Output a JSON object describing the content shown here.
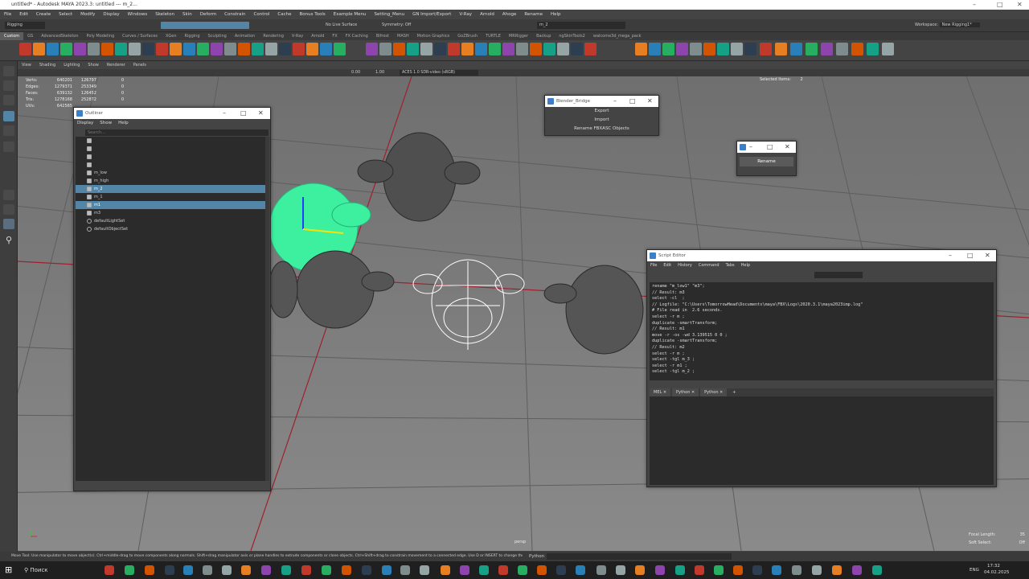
{
  "app": {
    "title": "untitled* - Autodesk MAYA 2023.3: untitled  ---  m_2...",
    "workspace_label": "Workspace:",
    "workspace_value": "New Rigging1*"
  },
  "menubar": [
    "File",
    "Edit",
    "Create",
    "Select",
    "Modify",
    "Display",
    "Windows",
    "Skeleton",
    "Skin",
    "Deform",
    "Constrain",
    "Control",
    "Cache",
    "Bonus Tools",
    "Example Menu",
    "Setting_Menu",
    "GN Import/Export",
    "V-Ray",
    "Arnold",
    "Ahoge",
    "Rename",
    "Help"
  ],
  "statusline": {
    "menuset": "Rigging",
    "live": "No Live Surface",
    "symmetry": "Symmetry: Off",
    "search": "m_2"
  },
  "shelf_tabs": [
    "Custom",
    "GS",
    "AdvancedSkeleton",
    "Poly Modeling",
    "Curves / Surfaces",
    "XGen",
    "Rigging",
    "Sculpting",
    "Animation",
    "Rendering",
    "V-Ray",
    "Arnold",
    "FX",
    "FX Caching",
    "Bifrost",
    "MASH",
    "Motion Graphics",
    "GoZBrush",
    "TURTLE",
    "MRRigger",
    "Backup",
    "ngSkinTools2",
    "walcome3d_mega_pack"
  ],
  "panel_menu": [
    "View",
    "Shading",
    "Lighting",
    "Show",
    "Renderer",
    "Panels"
  ],
  "panel_toolbar": {
    "value1": "0.00",
    "value2": "1.00",
    "colorspace": "ACES 1.0 SDR-video (sRGB)"
  },
  "hud": {
    "rows": [
      {
        "label": "Verts:",
        "a": "640201",
        "b": "126797",
        "c": "0"
      },
      {
        "label": "Edges:",
        "a": "1279371",
        "b": "253349",
        "c": "0"
      },
      {
        "label": "Faces:",
        "a": "639132",
        "b": "126452",
        "c": "0"
      },
      {
        "label": "Tris:",
        "a": "1278168",
        "b": "252872",
        "c": "0"
      },
      {
        "label": "UVs:",
        "a": "642565",
        "b": "",
        "c": ""
      }
    ],
    "selected_label": "Selected Items:",
    "selected_value": "2",
    "camera": "persp",
    "focal_label": "Focal Length:",
    "focal_value": "35",
    "softsel_label": "Soft Select:",
    "softsel_value": "Off"
  },
  "outliner": {
    "title": "Outliner",
    "menu": [
      "Display",
      "Show",
      "Help"
    ],
    "search_placeholder": "Search...",
    "items": [
      {
        "name": "",
        "selected": false,
        "dim": true,
        "type": "mesh"
      },
      {
        "name": "",
        "selected": false,
        "dim": true,
        "type": "mesh"
      },
      {
        "name": "",
        "selected": false,
        "dim": true,
        "type": "mesh"
      },
      {
        "name": "",
        "selected": false,
        "dim": true,
        "type": "mesh"
      },
      {
        "name": "m_low",
        "selected": false,
        "dim": false,
        "type": "mesh"
      },
      {
        "name": "m_high",
        "selected": false,
        "dim": false,
        "type": "mesh"
      },
      {
        "name": "m_2",
        "selected": true,
        "dim": false,
        "type": "mesh"
      },
      {
        "name": "m_1",
        "selected": false,
        "dim": false,
        "type": "mesh"
      },
      {
        "name": "m1",
        "selected": true,
        "dim": false,
        "type": "mesh"
      },
      {
        "name": "m3",
        "selected": false,
        "dim": false,
        "type": "mesh"
      },
      {
        "name": "defaultLightSet",
        "selected": false,
        "dim": false,
        "type": "set"
      },
      {
        "name": "defaultObjectSet",
        "selected": false,
        "dim": false,
        "type": "set"
      }
    ]
  },
  "blender_bridge": {
    "title": "Blender_Bridge",
    "buttons": [
      "Export",
      "Import",
      "Rename FBXASC Objects"
    ]
  },
  "rename_window": {
    "button": "Rename"
  },
  "script_editor": {
    "title": "Script Editor",
    "menu": [
      "File",
      "Edit",
      "History",
      "Command",
      "Tabs",
      "Help"
    ],
    "history": [
      "rename \"m_low1\" \"m3\";",
      "// Result: m3",
      "select -cl  ;",
      "// Logfile: \"C:\\Users\\TomorrowHead\\Documents\\maya\\FBX\\Logs\\2020.3.1\\maya2023imp.log\"",
      "# File read in  2.6 seconds.",
      "select -r m ;",
      "duplicate -smartTransform;",
      "// Result: m1",
      "move -r -os -wd 3.139515 0 0 ;",
      "duplicate -smartTransform;",
      "// Result: m2",
      "select -r m ;",
      "select -tgl m_3 ;",
      "select -r m1 ;",
      "select -tgl m_2 ;"
    ],
    "tabs": [
      "MEL",
      "Python",
      "Python"
    ]
  },
  "helpline": {
    "text": "Move Tool: Use manipulator to move object(s). Ctrl+middle-drag to move components along normals. Shift+drag manipulator axis or plane handles to extrude components or clone objects. Ctrl+Shift+drag to constrain movement to a connected edge. Use D or INSERT to change the pi",
    "lang": "Python"
  },
  "taskbar": {
    "search": "Поиск",
    "lang": "ENG",
    "time": "17:32",
    "date": "04.02.2025"
  },
  "colors": {
    "selection": "#5285a6",
    "highlight_mesh": "#3cf0a0",
    "grid_axis": "#a02030"
  }
}
